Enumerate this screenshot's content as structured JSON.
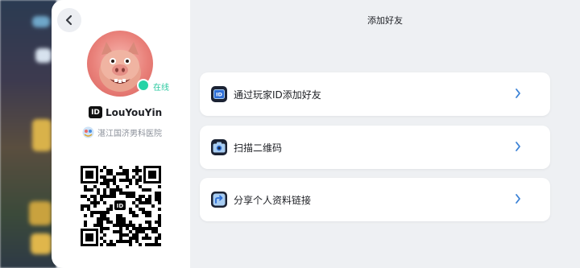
{
  "profile": {
    "online_label": "在线",
    "id_badge": "ID",
    "username": "LouYouYin",
    "hospital": "湛江国济男科医院",
    "qr_center_badge": "ID"
  },
  "page": {
    "title": "添加好友"
  },
  "options": [
    {
      "label": "通过玩家ID添加好友",
      "icon": "id-card-icon"
    },
    {
      "label": "扫描二维码",
      "icon": "camera-icon"
    },
    {
      "label": "分享个人资料链接",
      "icon": "share-icon"
    }
  ],
  "colors": {
    "online": "#27d3a6",
    "chevron": "#3b82d6",
    "icon_blue": "#2f6fd6",
    "icon_light": "#a8cdf2"
  }
}
